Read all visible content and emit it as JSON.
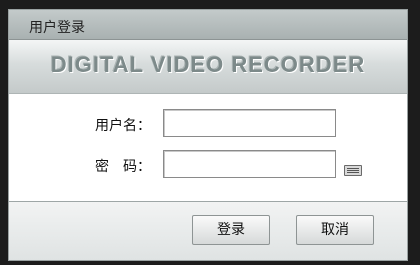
{
  "dialog": {
    "title": "用户登录",
    "banner": "DIGITAL VIDEO RECORDER"
  },
  "form": {
    "username_label": "用户名：",
    "username_value": "",
    "password_label": "密　码：",
    "password_value": ""
  },
  "buttons": {
    "login_label": "登录",
    "cancel_label": "取消"
  },
  "icons": {
    "keyboard": "keyboard-icon"
  }
}
